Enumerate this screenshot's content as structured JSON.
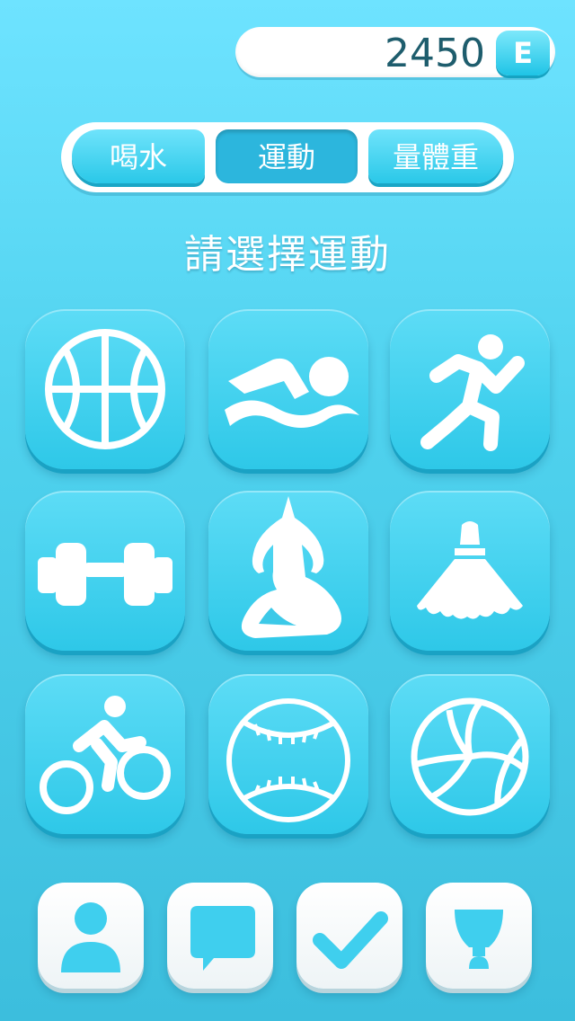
{
  "score": {
    "value": "2450",
    "badge": "E"
  },
  "tabs": [
    {
      "label": "喝水",
      "active": false
    },
    {
      "label": "運動",
      "active": true
    },
    {
      "label": "量體重",
      "active": false
    }
  ],
  "prompt": "請選擇運動",
  "sports": [
    {
      "icon": "basketball-icon"
    },
    {
      "icon": "swimming-icon"
    },
    {
      "icon": "running-icon"
    },
    {
      "icon": "dumbbell-icon"
    },
    {
      "icon": "yoga-icon"
    },
    {
      "icon": "badminton-shuttlecock-icon"
    },
    {
      "icon": "cycling-icon"
    },
    {
      "icon": "baseball-icon"
    },
    {
      "icon": "volleyball-icon"
    }
  ],
  "bottom_nav": [
    {
      "icon": "profile-icon"
    },
    {
      "icon": "message-icon"
    },
    {
      "icon": "checkmark-icon"
    },
    {
      "icon": "trophy-icon"
    }
  ],
  "colors": {
    "accent": "#2ac8e8",
    "nav_icon": "#3fcfee",
    "text_dark": "#1e5d6d"
  }
}
